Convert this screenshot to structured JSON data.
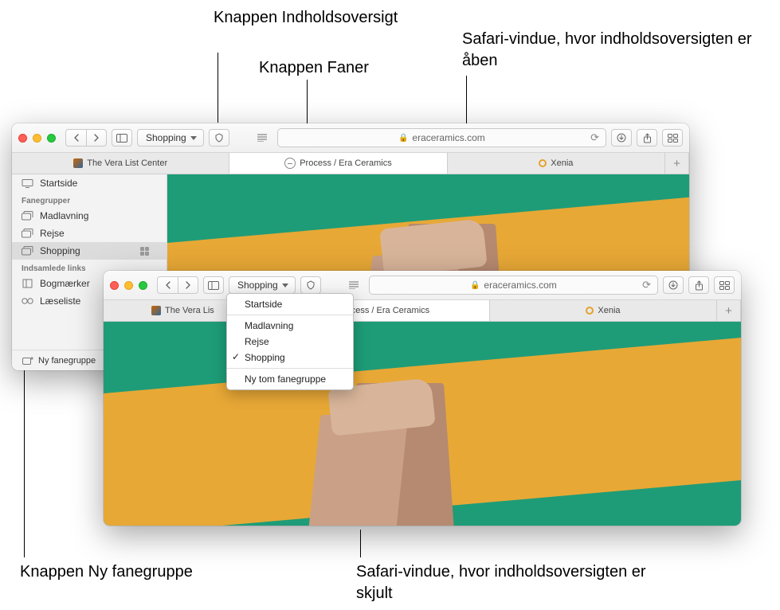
{
  "callouts": {
    "top_left_1": "Knappen Indholdsoversigt",
    "top_left_2": "Knappen Faner",
    "top_right": "Safari-vindue, hvor indholdsoversigten er åben",
    "bottom_left": "Knappen Ny fanegruppe",
    "bottom_right": "Safari-vindue, hvor indholdsoversigten er skjult"
  },
  "window1": {
    "toolbar": {
      "tabgroup_label": "Shopping",
      "address": "eraceramics.com"
    },
    "tabs": [
      {
        "label": "The Vera List Center",
        "favicon": "vera",
        "active": false
      },
      {
        "label": "Process / Era Ceramics",
        "favicon": "era",
        "active": true
      },
      {
        "label": "Xenia",
        "favicon": "xenia",
        "active": false
      }
    ],
    "sidebar": {
      "start": "Startside",
      "groups_header": "Fanegrupper",
      "groups": [
        "Madlavning",
        "Rejse",
        "Shopping"
      ],
      "selected_group": "Shopping",
      "links_header": "Indsamlede links",
      "bookmarks": "Bogmærker",
      "readinglist": "Læseliste",
      "new_group": "Ny fanegruppe"
    }
  },
  "window2": {
    "toolbar": {
      "tabgroup_label": "Shopping",
      "address": "eraceramics.com"
    },
    "tabs": [
      {
        "label": "The Vera Lis",
        "favicon": "vera",
        "active": false
      },
      {
        "label": "Process / Era Ceramics",
        "favicon": "era",
        "active": true
      },
      {
        "label": "Xenia",
        "favicon": "xenia",
        "active": false
      }
    ],
    "dropdown": {
      "start": "Startside",
      "items": [
        "Madlavning",
        "Rejse",
        "Shopping"
      ],
      "checked": "Shopping",
      "new_empty": "Ny tom fanegruppe"
    }
  }
}
